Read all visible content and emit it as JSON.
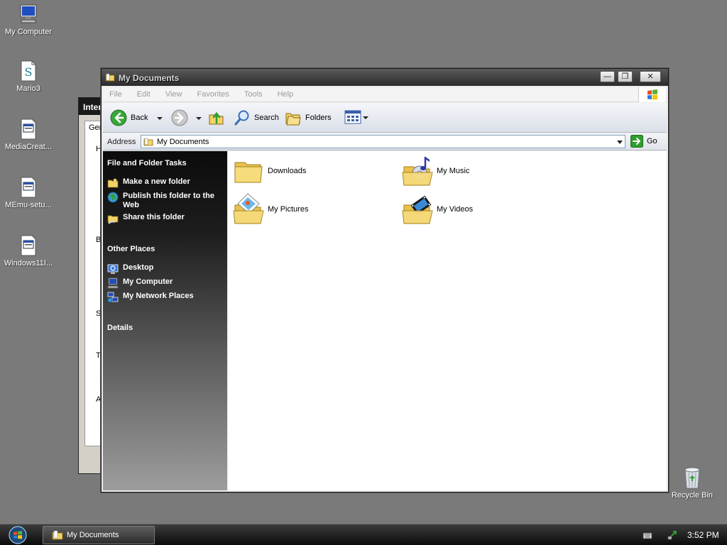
{
  "desktop": {
    "icons": [
      {
        "label": "My Computer"
      },
      {
        "label": "Mario3"
      },
      {
        "label": "MediaCreat..."
      },
      {
        "label": "MEmu-setu..."
      },
      {
        "label": "Windows11I..."
      }
    ],
    "recycle_bin": "Recycle Bin"
  },
  "background_window": {
    "title": "Interr",
    "tab": "Ger",
    "letters": [
      "H",
      "B",
      "S",
      "T",
      "A"
    ]
  },
  "window": {
    "title": "My Documents",
    "controls": {
      "minimize": "—",
      "restore": "❐",
      "close": "✕"
    },
    "menu": [
      "File",
      "Edit",
      "View",
      "Favorites",
      "Tools",
      "Help"
    ],
    "toolbar": {
      "back": "Back",
      "search": "Search",
      "folders": "Folders"
    },
    "address": {
      "label": "Address",
      "value": "My Documents",
      "go": "Go"
    },
    "task_pane": {
      "file_tasks_title": "File and Folder Tasks",
      "file_tasks": [
        {
          "label": "Make a new folder",
          "icon": "new-folder-icon"
        },
        {
          "label": "Publish this folder to the Web",
          "icon": "publish-web-icon"
        },
        {
          "label": "Share this folder",
          "icon": "share-folder-icon"
        }
      ],
      "other_places_title": "Other Places",
      "other_places": [
        {
          "label": "Desktop",
          "icon": "desktop-icon"
        },
        {
          "label": "My Computer",
          "icon": "my-computer-icon"
        },
        {
          "label": "My Network Places",
          "icon": "network-places-icon"
        }
      ],
      "details_title": "Details"
    },
    "files": [
      {
        "label": "Downloads",
        "icon": "folder-icon"
      },
      {
        "label": "My Music",
        "icon": "music-folder-icon"
      },
      {
        "label": "My Pictures",
        "icon": "pictures-folder-icon"
      },
      {
        "label": "My Videos",
        "icon": "videos-folder-icon"
      }
    ]
  },
  "taskbar": {
    "active_task": "My Documents",
    "clock": "3:52 PM"
  },
  "colors": {
    "desktop": "#7a7a7a",
    "folder": "#f2d36b",
    "accent_green": "#2e9e2e"
  }
}
